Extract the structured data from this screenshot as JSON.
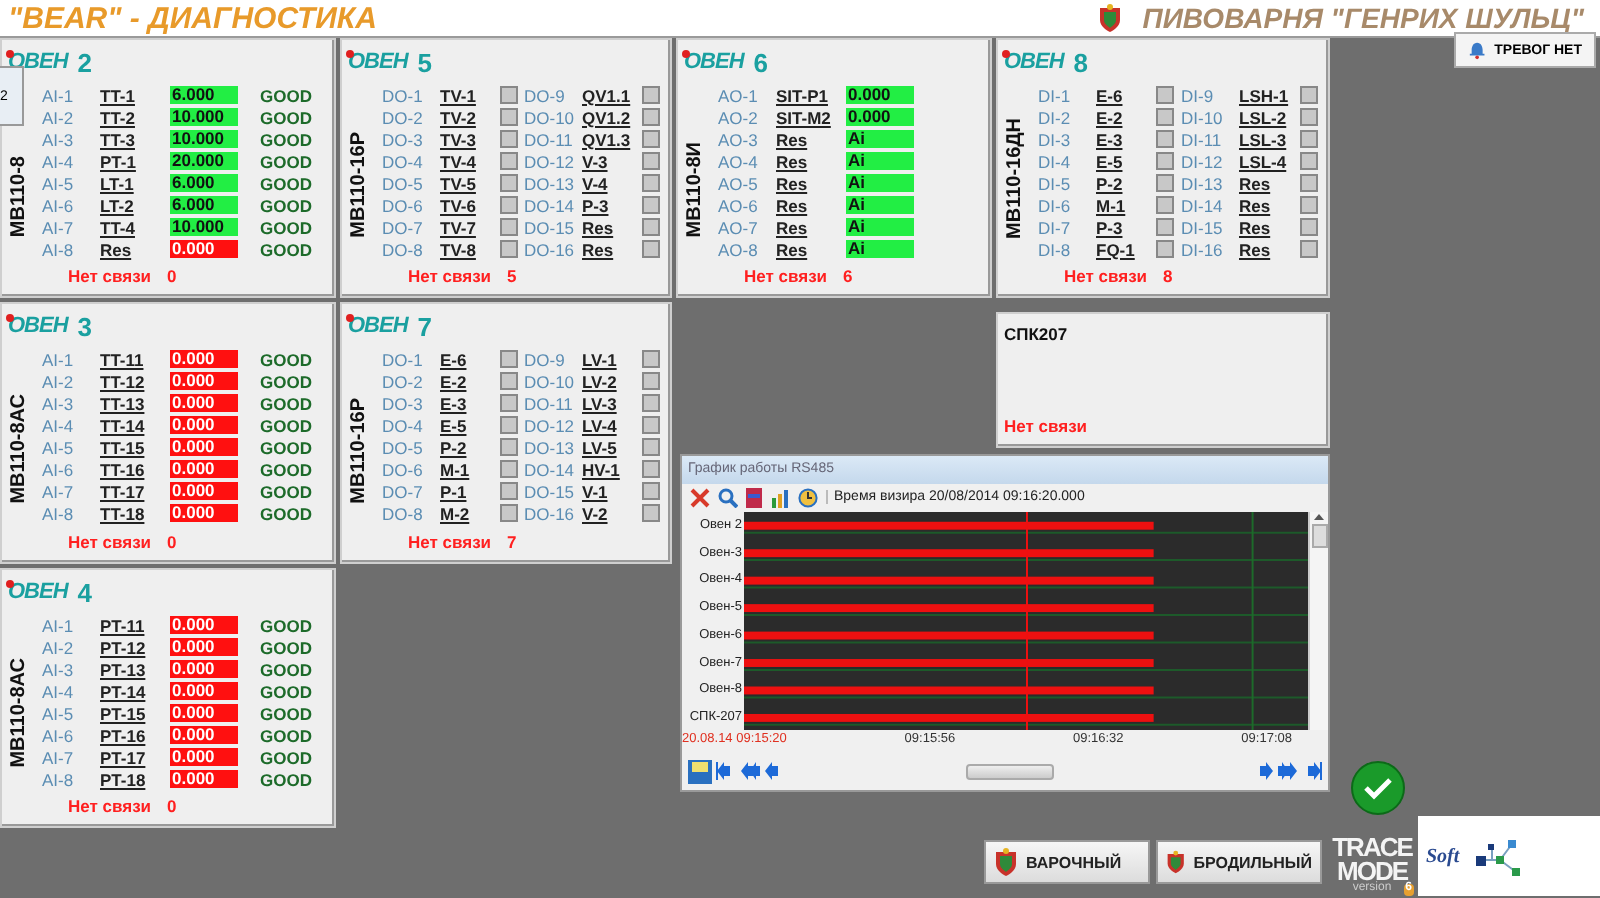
{
  "header": {
    "title": "\"BEAR\" - ДИАГНОСТИКА",
    "brewery": "ПИВОВАРНЯ \"ГЕНРИХ ШУЛЬЦ\""
  },
  "alarm_button": {
    "label": "ТРЕВОГ НЕТ"
  },
  "popup": {
    "text": "2"
  },
  "panels": [
    {
      "kind": "analog",
      "logo": "ОВЕН",
      "number": "2",
      "module": "МВ110-8",
      "rows": [
        {
          "channel": "AI-1",
          "tag": "TT-1",
          "value": "6.000",
          "alarm": false,
          "status": "GOOD"
        },
        {
          "channel": "AI-2",
          "tag": "TT-2",
          "value": "10.000",
          "alarm": false,
          "status": "GOOD"
        },
        {
          "channel": "AI-3",
          "tag": "TT-3",
          "value": "10.000",
          "alarm": false,
          "status": "GOOD"
        },
        {
          "channel": "AI-4",
          "tag": "PT-1",
          "value": "20.000",
          "alarm": false,
          "status": "GOOD"
        },
        {
          "channel": "AI-5",
          "tag": "LT-1",
          "value": "6.000",
          "alarm": false,
          "status": "GOOD"
        },
        {
          "channel": "AI-6",
          "tag": "LT-2",
          "value": "6.000",
          "alarm": false,
          "status": "GOOD"
        },
        {
          "channel": "AI-7",
          "tag": "TT-4",
          "value": "10.000",
          "alarm": false,
          "status": "GOOD"
        },
        {
          "channel": "AI-8",
          "tag": "Res",
          "value": "0.000",
          "alarm": true,
          "status": "GOOD"
        }
      ],
      "footer": {
        "label": "Нет связи",
        "count": "0"
      }
    },
    {
      "kind": "discrete",
      "logo": "ОВЕН",
      "number": "5",
      "module": "МВ110-16Р",
      "rows": [
        {
          "channel": "DO-1",
          "tag": "TV-1",
          "checked": false
        },
        {
          "channel": "DO-2",
          "tag": "TV-2",
          "checked": false
        },
        {
          "channel": "DO-3",
          "tag": "TV-3",
          "checked": false
        },
        {
          "channel": "DO-4",
          "tag": "TV-4",
          "checked": false
        },
        {
          "channel": "DO-5",
          "tag": "TV-5",
          "checked": false
        },
        {
          "channel": "DO-6",
          "tag": "TV-6",
          "checked": false
        },
        {
          "channel": "DO-7",
          "tag": "TV-7",
          "checked": false
        },
        {
          "channel": "DO-8",
          "tag": "TV-8",
          "checked": false
        },
        {
          "channel": "DO-9",
          "tag": "QV1.1",
          "checked": false
        },
        {
          "channel": "DO-10",
          "tag": "QV1.2",
          "checked": false
        },
        {
          "channel": "DO-11",
          "tag": "QV1.3",
          "checked": false
        },
        {
          "channel": "DO-12",
          "tag": "V-3",
          "checked": false
        },
        {
          "channel": "DO-13",
          "tag": "V-4",
          "checked": false
        },
        {
          "channel": "DO-14",
          "tag": "P-3",
          "checked": false
        },
        {
          "channel": "DO-15",
          "tag": "Res",
          "checked": false
        },
        {
          "channel": "DO-16",
          "tag": "Res",
          "checked": false
        }
      ],
      "footer": {
        "label": "Нет связи",
        "count": "5"
      }
    },
    {
      "kind": "analog",
      "logo": "ОВЕН",
      "number": "6",
      "module": "МВ110-8И",
      "rows": [
        {
          "channel": "AO-1",
          "tag": "SIT-P1",
          "value": "0.000",
          "alarm": false
        },
        {
          "channel": "AO-2",
          "tag": "SIT-M2",
          "value": "0.000",
          "alarm": false
        },
        {
          "channel": "AO-3",
          "tag": "Res",
          "value": "Ai",
          "alarm": false
        },
        {
          "channel": "AO-4",
          "tag": "Res",
          "value": "Ai",
          "alarm": false
        },
        {
          "channel": "AO-5",
          "tag": "Res",
          "value": "Ai",
          "alarm": false
        },
        {
          "channel": "AO-6",
          "tag": "Res",
          "value": "Ai",
          "alarm": false
        },
        {
          "channel": "AO-7",
          "tag": "Res",
          "value": "Ai",
          "alarm": false
        },
        {
          "channel": "AO-8",
          "tag": "Res",
          "value": "Ai",
          "alarm": false
        }
      ],
      "footer": {
        "label": "Нет связи",
        "count": "6"
      }
    },
    {
      "kind": "discrete",
      "logo": "ОВЕН",
      "number": "8",
      "module": "МВ110-16ДН",
      "rows": [
        {
          "channel": "DI-1",
          "tag": "E-6",
          "checked": false
        },
        {
          "channel": "DI-2",
          "tag": "E-2",
          "checked": false
        },
        {
          "channel": "DI-3",
          "tag": "E-3",
          "checked": false
        },
        {
          "channel": "DI-4",
          "tag": "E-5",
          "checked": false
        },
        {
          "channel": "DI-5",
          "tag": "P-2",
          "checked": false
        },
        {
          "channel": "DI-6",
          "tag": "M-1",
          "checked": false
        },
        {
          "channel": "DI-7",
          "tag": "P-3",
          "checked": false
        },
        {
          "channel": "DI-8",
          "tag": "FQ-1",
          "checked": false
        },
        {
          "channel": "DI-9",
          "tag": "LSH-1",
          "checked": false
        },
        {
          "channel": "DI-10",
          "tag": "LSL-2",
          "checked": false
        },
        {
          "channel": "DI-11",
          "tag": "LSL-3",
          "checked": false
        },
        {
          "channel": "DI-12",
          "tag": "LSL-4",
          "checked": false
        },
        {
          "channel": "DI-13",
          "tag": "Res",
          "checked": false
        },
        {
          "channel": "DI-14",
          "tag": "Res",
          "checked": false
        },
        {
          "channel": "DI-15",
          "tag": "Res",
          "checked": false
        },
        {
          "channel": "DI-16",
          "tag": "Res",
          "checked": false
        }
      ],
      "footer": {
        "label": "Нет связи",
        "count": "8"
      }
    },
    {
      "kind": "analog",
      "logo": "ОВЕН",
      "number": "3",
      "module": "МВ110-8АС",
      "rows": [
        {
          "channel": "AI-1",
          "tag": "TT-11",
          "value": "0.000",
          "alarm": true,
          "status": "GOOD"
        },
        {
          "channel": "AI-2",
          "tag": "TT-12",
          "value": "0.000",
          "alarm": true,
          "status": "GOOD"
        },
        {
          "channel": "AI-3",
          "tag": "TT-13",
          "value": "0.000",
          "alarm": true,
          "status": "GOOD"
        },
        {
          "channel": "AI-4",
          "tag": "TT-14",
          "value": "0.000",
          "alarm": true,
          "status": "GOOD"
        },
        {
          "channel": "AI-5",
          "tag": "TT-15",
          "value": "0.000",
          "alarm": true,
          "status": "GOOD"
        },
        {
          "channel": "AI-6",
          "tag": "TT-16",
          "value": "0.000",
          "alarm": true,
          "status": "GOOD"
        },
        {
          "channel": "AI-7",
          "tag": "TT-17",
          "value": "0.000",
          "alarm": true,
          "status": "GOOD"
        },
        {
          "channel": "AI-8",
          "tag": "TT-18",
          "value": "0.000",
          "alarm": true,
          "status": "GOOD"
        }
      ],
      "footer": {
        "label": "Нет связи",
        "count": "0"
      }
    },
    {
      "kind": "discrete",
      "logo": "ОВЕН",
      "number": "7",
      "module": "МВ110-16Р",
      "rows": [
        {
          "channel": "DO-1",
          "tag": "E-6",
          "checked": false
        },
        {
          "channel": "DO-2",
          "tag": "E-2",
          "checked": false
        },
        {
          "channel": "DO-3",
          "tag": "E-3",
          "checked": false
        },
        {
          "channel": "DO-4",
          "tag": "E-5",
          "checked": false
        },
        {
          "channel": "DO-5",
          "tag": "P-2",
          "checked": false
        },
        {
          "channel": "DO-6",
          "tag": "M-1",
          "checked": false
        },
        {
          "channel": "DO-7",
          "tag": "P-1",
          "checked": false
        },
        {
          "channel": "DO-8",
          "tag": "M-2",
          "checked": false
        },
        {
          "channel": "DO-9",
          "tag": "LV-1",
          "checked": false
        },
        {
          "channel": "DO-10",
          "tag": "LV-2",
          "checked": false
        },
        {
          "channel": "DO-11",
          "tag": "LV-3",
          "checked": false
        },
        {
          "channel": "DO-12",
          "tag": "LV-4",
          "checked": false
        },
        {
          "channel": "DO-13",
          "tag": "LV-5",
          "checked": false
        },
        {
          "channel": "DO-14",
          "tag": "HV-1",
          "checked": false
        },
        {
          "channel": "DO-15",
          "tag": "V-1",
          "checked": false
        },
        {
          "channel": "DO-16",
          "tag": "V-2",
          "checked": false
        }
      ],
      "footer": {
        "label": "Нет связи",
        "count": "7"
      }
    },
    {
      "kind": "controller",
      "title": "СПК207",
      "footer": {
        "label": "Нет связи"
      }
    },
    {
      "kind": "analog",
      "logo": "ОВЕН",
      "number": "4",
      "module": "МВ110-8АС",
      "rows": [
        {
          "channel": "AI-1",
          "tag": "PT-11",
          "value": "0.000",
          "alarm": true,
          "status": "GOOD"
        },
        {
          "channel": "AI-2",
          "tag": "PT-12",
          "value": "0.000",
          "alarm": true,
          "status": "GOOD"
        },
        {
          "channel": "AI-3",
          "tag": "PT-13",
          "value": "0.000",
          "alarm": true,
          "status": "GOOD"
        },
        {
          "channel": "AI-4",
          "tag": "PT-14",
          "value": "0.000",
          "alarm": true,
          "status": "GOOD"
        },
        {
          "channel": "AI-5",
          "tag": "PT-15",
          "value": "0.000",
          "alarm": true,
          "status": "GOOD"
        },
        {
          "channel": "AI-6",
          "tag": "PT-16",
          "value": "0.000",
          "alarm": true,
          "status": "GOOD"
        },
        {
          "channel": "AI-7",
          "tag": "PT-17",
          "value": "0.000",
          "alarm": true,
          "status": "GOOD"
        },
        {
          "channel": "AI-8",
          "tag": "PT-18",
          "value": "0.000",
          "alarm": true,
          "status": "GOOD"
        }
      ],
      "footer": {
        "label": "Нет связи",
        "count": "0"
      }
    }
  ],
  "trend_window": {
    "title": "График работы RS485",
    "cursor_time": "Время визира 20/08/2014 09:16:20.000",
    "rows": [
      "Овен 2",
      "Овен-3",
      "Овен-4",
      "Овен-5",
      "Овен-6",
      "Овен-7",
      "Овен-8",
      "СПК-207"
    ],
    "time_labels": [
      {
        "text": "20.08.14 09:15:20",
        "kind": "start"
      },
      {
        "text": "09:15:56",
        "kind": "tick"
      },
      {
        "text": "09:16:32",
        "kind": "tick"
      },
      {
        "text": "09:17:08",
        "kind": "tick"
      }
    ]
  },
  "bottom_buttons": [
    {
      "label": "ВАРОЧНЫЙ"
    },
    {
      "label": "БРОДИЛЬНЫЙ"
    }
  ],
  "trace_logo": {
    "lines": [
      "TRACE",
      "MODE"
    ],
    "version": "version",
    "badge": "6"
  },
  "soft_logo": {
    "text": "Soft"
  }
}
